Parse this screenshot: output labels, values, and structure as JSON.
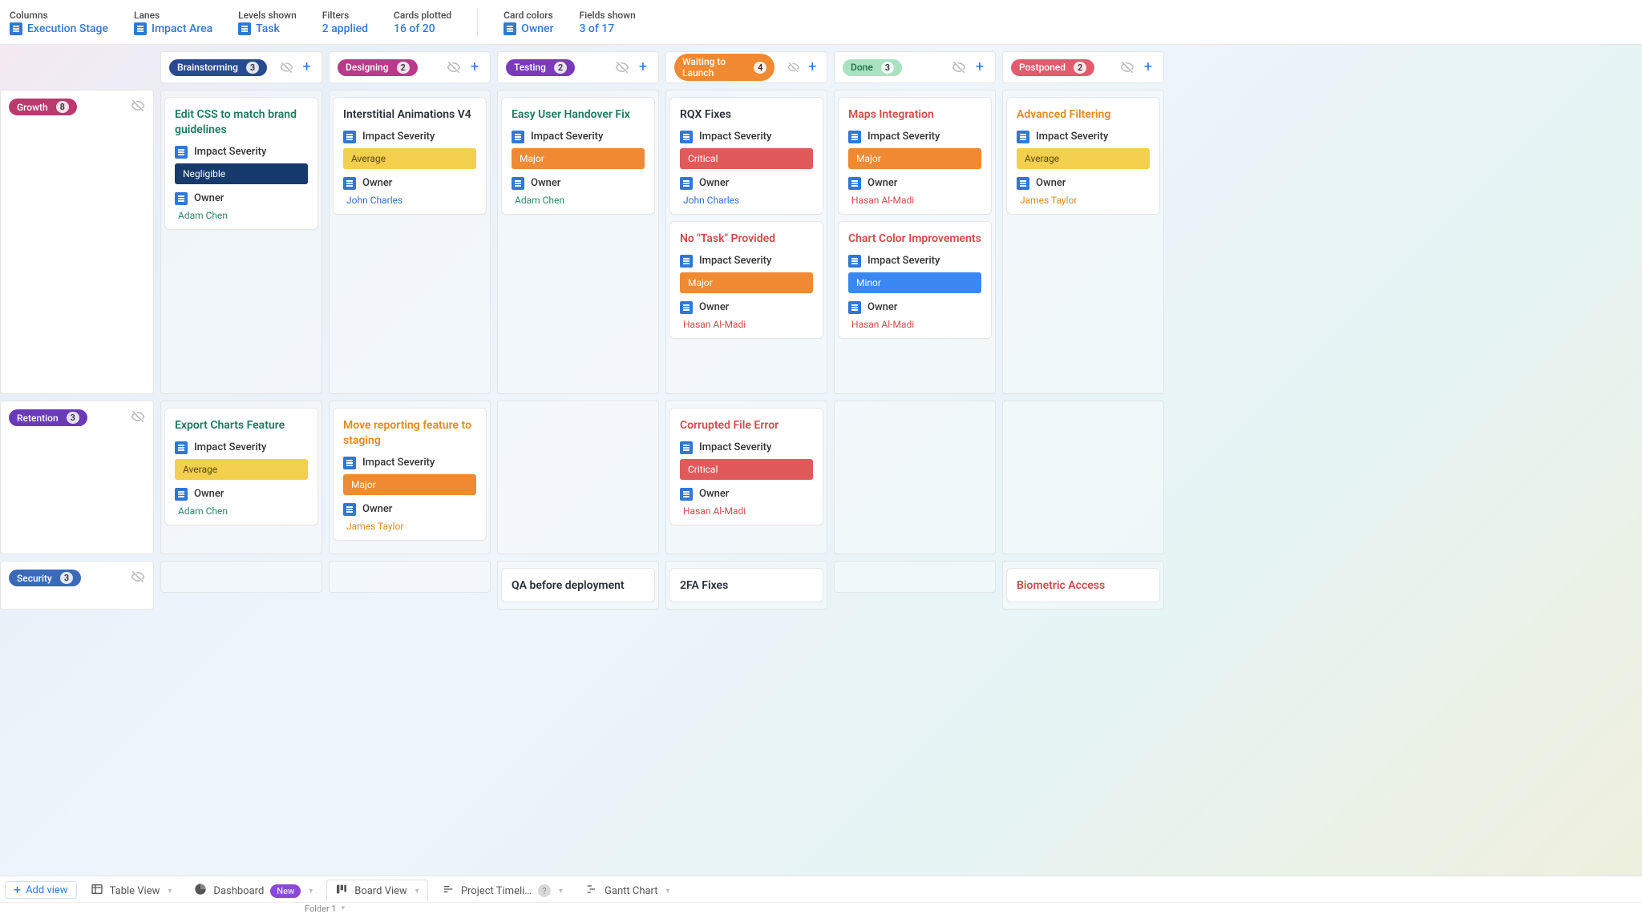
{
  "topbar": {
    "columns": {
      "label": "Columns",
      "value": "Execution Stage"
    },
    "lanes": {
      "label": "Lanes",
      "value": "Impact Area"
    },
    "levels": {
      "label": "Levels shown",
      "value": "Task"
    },
    "filters": {
      "label": "Filters",
      "value": "2 applied"
    },
    "cards": {
      "label": "Cards plotted",
      "value": "16 of 20"
    },
    "colors": {
      "label": "Card colors",
      "value": "Owner"
    },
    "fields": {
      "label": "Fields shown",
      "value": "3 of 17"
    }
  },
  "field_labels": {
    "impact_severity": "Impact Severity",
    "owner": "Owner"
  },
  "columns": [
    {
      "id": "brainstorming",
      "label": "Brainstorming",
      "count": 3,
      "pill": "p-brain"
    },
    {
      "id": "designing",
      "label": "Designing",
      "count": 2,
      "pill": "p-design"
    },
    {
      "id": "testing",
      "label": "Testing",
      "count": 2,
      "pill": "p-test"
    },
    {
      "id": "waiting",
      "label": "Waiting to Launch",
      "count": 4,
      "pill": "p-wait"
    },
    {
      "id": "done",
      "label": "Done",
      "count": 3,
      "pill": "p-done"
    },
    {
      "id": "postponed",
      "label": "Postponed",
      "count": 2,
      "pill": "p-post"
    }
  ],
  "lanes": [
    {
      "id": "growth",
      "label": "Growth",
      "count": 8,
      "pill": "p-growth",
      "rowClass": "tall1"
    },
    {
      "id": "retention",
      "label": "Retention",
      "count": 3,
      "pill": "p-ret",
      "rowClass": "tall2"
    },
    {
      "id": "security",
      "label": "Security",
      "count": 3,
      "pill": "p-sec",
      "rowClass": "tall3"
    }
  ],
  "severity_classes": {
    "Negligible": "sv-negl",
    "Average": "sv-avg",
    "Major": "sv-major",
    "Critical": "sv-crit",
    "Minor": "sv-minor"
  },
  "owner_classes": {
    "Adam Chen": "ow-green",
    "John Charles": "ow-blue",
    "Hasan Al-Madi": "ow-red",
    "James Taylor": "ow-orange"
  },
  "cells": {
    "growth": {
      "brainstorming": [
        {
          "title": "Edit CSS to match brand guidelines",
          "titleClass": "t-green",
          "severity": "Negligible",
          "owner": "Adam Chen"
        }
      ],
      "designing": [
        {
          "title": "Interstitial Animations V4",
          "titleClass": "t-dark",
          "severity": "Average",
          "owner": "John Charles"
        }
      ],
      "testing": [
        {
          "title": "Easy User Handover Fix",
          "titleClass": "t-green",
          "severity": "Major",
          "owner": "Adam Chen"
        }
      ],
      "waiting": [
        {
          "title": "RQX Fixes",
          "titleClass": "t-dark",
          "severity": "Critical",
          "owner": "John Charles"
        },
        {
          "title": "No \"Task\" Provided",
          "titleClass": "t-red",
          "severity": "Major",
          "owner": "Hasan Al-Madi"
        }
      ],
      "done": [
        {
          "title": "Maps Integration",
          "titleClass": "t-red",
          "severity": "Major",
          "owner": "Hasan Al-Madi"
        },
        {
          "title": "Chart Color Improvements",
          "titleClass": "t-red",
          "severity": "Minor",
          "owner": "Hasan Al-Madi"
        }
      ],
      "postponed": [
        {
          "title": "Advanced Filtering",
          "titleClass": "t-orange",
          "severity": "Average",
          "owner": "James Taylor"
        }
      ]
    },
    "retention": {
      "brainstorming": [
        {
          "title": "Export Charts Feature",
          "titleClass": "t-green",
          "severity": "Average",
          "owner": "Adam Chen"
        }
      ],
      "designing": [
        {
          "title": "Move reporting feature to staging",
          "titleClass": "t-orange",
          "severity": "Major",
          "owner": "James Taylor"
        }
      ],
      "testing": [],
      "waiting": [
        {
          "title": "Corrupted File Error",
          "titleClass": "t-red",
          "severity": "Critical",
          "owner": "Hasan Al-Madi"
        }
      ],
      "done": [],
      "postponed": []
    },
    "security": {
      "brainstorming": [],
      "designing": [],
      "testing": [
        {
          "title": "QA before deployment",
          "titleClass": "t-dark",
          "partial": true
        }
      ],
      "waiting": [
        {
          "title": "2FA Fixes",
          "titleClass": "t-dark",
          "partial": true
        }
      ],
      "done": [],
      "postponed": [
        {
          "title": "Biometric Access",
          "titleClass": "t-red",
          "partial": true
        }
      ]
    }
  },
  "tabs": {
    "addview": "Add view",
    "list": [
      {
        "id": "table",
        "label": "Table View",
        "icon": "table"
      },
      {
        "id": "dashboard",
        "label": "Dashboard",
        "icon": "pie",
        "badge": "New"
      },
      {
        "id": "board",
        "label": "Board View",
        "icon": "board",
        "active": true
      },
      {
        "id": "timeline",
        "label": "Project Timeli…",
        "icon": "timeline",
        "help": true
      },
      {
        "id": "gantt",
        "label": "Gantt Chart",
        "icon": "gantt"
      }
    ],
    "folder": "Folder 1"
  }
}
